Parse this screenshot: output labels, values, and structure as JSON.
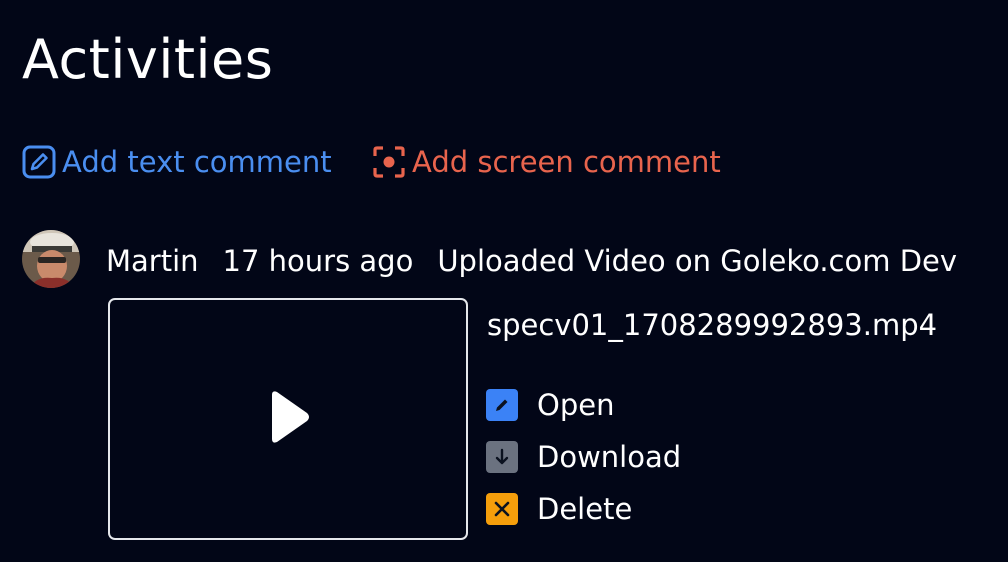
{
  "page": {
    "title": "Activities"
  },
  "actions": {
    "add_text_comment": {
      "label": "Add text comment",
      "color": "#4a8ef0",
      "icon": "edit-icon"
    },
    "add_screen_comment": {
      "label": "Add screen comment",
      "color": "#e8644d",
      "icon": "screen-capture-icon"
    }
  },
  "activity": {
    "user": "Martin",
    "time": "17 hours ago",
    "description": "Uploaded Video on Goleko.com Dev",
    "attachment": {
      "filename": "specv01_1708289992893.mp4",
      "thumbnail_icon": "play-icon"
    },
    "menu": {
      "open": {
        "label": "Open",
        "color": "#3b82f6",
        "icon": "pencil-icon"
      },
      "download": {
        "label": "Download",
        "color": "#6b7280",
        "icon": "arrow-down-icon"
      },
      "delete": {
        "label": "Delete",
        "color": "#f59e0b",
        "icon": "x-icon"
      }
    }
  }
}
